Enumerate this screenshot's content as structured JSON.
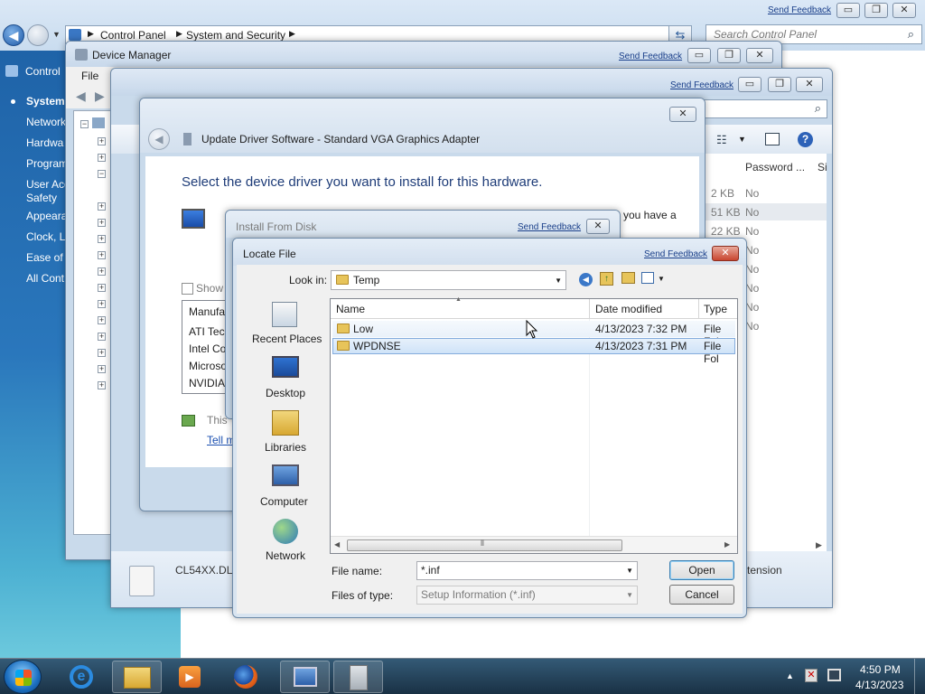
{
  "control_panel": {
    "breadcrumb": [
      "Control Panel",
      "System and Security"
    ],
    "search_placeholder": "Search Control Panel",
    "send_feedback": "Send Feedback",
    "sidebar_title": "Control",
    "sidebar_items": [
      "System",
      "Network",
      "Hardwa",
      "Program",
      "User Acc",
      "Safety",
      "Appeara",
      "Clock, L",
      "Ease of A",
      "All Cont"
    ]
  },
  "device_manager": {
    "title": "Device Manager",
    "send_feedback": "Send Feedback",
    "menu_file": "File"
  },
  "explorer": {
    "send_feedback": "Send Feedback",
    "col_password": "Password ...",
    "col_si": "Si",
    "sizes": [
      "2 KB",
      "51 KB",
      "22 KB"
    ],
    "password_values": [
      "No",
      "No",
      "No",
      "No",
      "No",
      "No",
      "No",
      "No"
    ],
    "file_name": "CL54XX.DLL",
    "extension_text": "tension"
  },
  "update_driver": {
    "title": "Update Driver Software - Standard VGA Graphics Adapter",
    "heading": "Select the device driver you want to install for this hardware.",
    "have_disk_text": "you have a",
    "show_label": "Show",
    "manufacturer_header": "Manufa",
    "manufacturers": [
      "ATI Tec",
      "Intel Co",
      "Microso",
      "NVIDIA"
    ],
    "signed_text": "This",
    "tell_me_link": "Tell m"
  },
  "install_from_disk": {
    "title": "Install From Disk",
    "send_feedback": "Send Feedback"
  },
  "locate_file": {
    "title": "Locate File",
    "send_feedback": "Send Feedback",
    "look_in_label": "Look in:",
    "look_in_value": "Temp",
    "places": [
      "Recent Places",
      "Desktop",
      "Libraries",
      "Computer",
      "Network"
    ],
    "columns": {
      "name": "Name",
      "date": "Date modified",
      "type": "Type"
    },
    "files": [
      {
        "name": "Low",
        "date": "4/13/2023 7:32 PM",
        "type": "File Fol"
      },
      {
        "name": "WPDNSE",
        "date": "4/13/2023 7:31 PM",
        "type": "File Fol"
      }
    ],
    "file_name_label": "File name:",
    "file_name_value": "*.inf",
    "files_of_type_label": "Files of type:",
    "files_of_type_value": "Setup Information (*.inf)",
    "open_button": "Open",
    "cancel_button": "Cancel"
  },
  "taskbar": {
    "time": "4:50 PM",
    "date": "4/13/2023",
    "apps": [
      "windows-explorer",
      "internet-explorer",
      "media-player",
      "firefox",
      "display-settings",
      "device-manager"
    ]
  }
}
